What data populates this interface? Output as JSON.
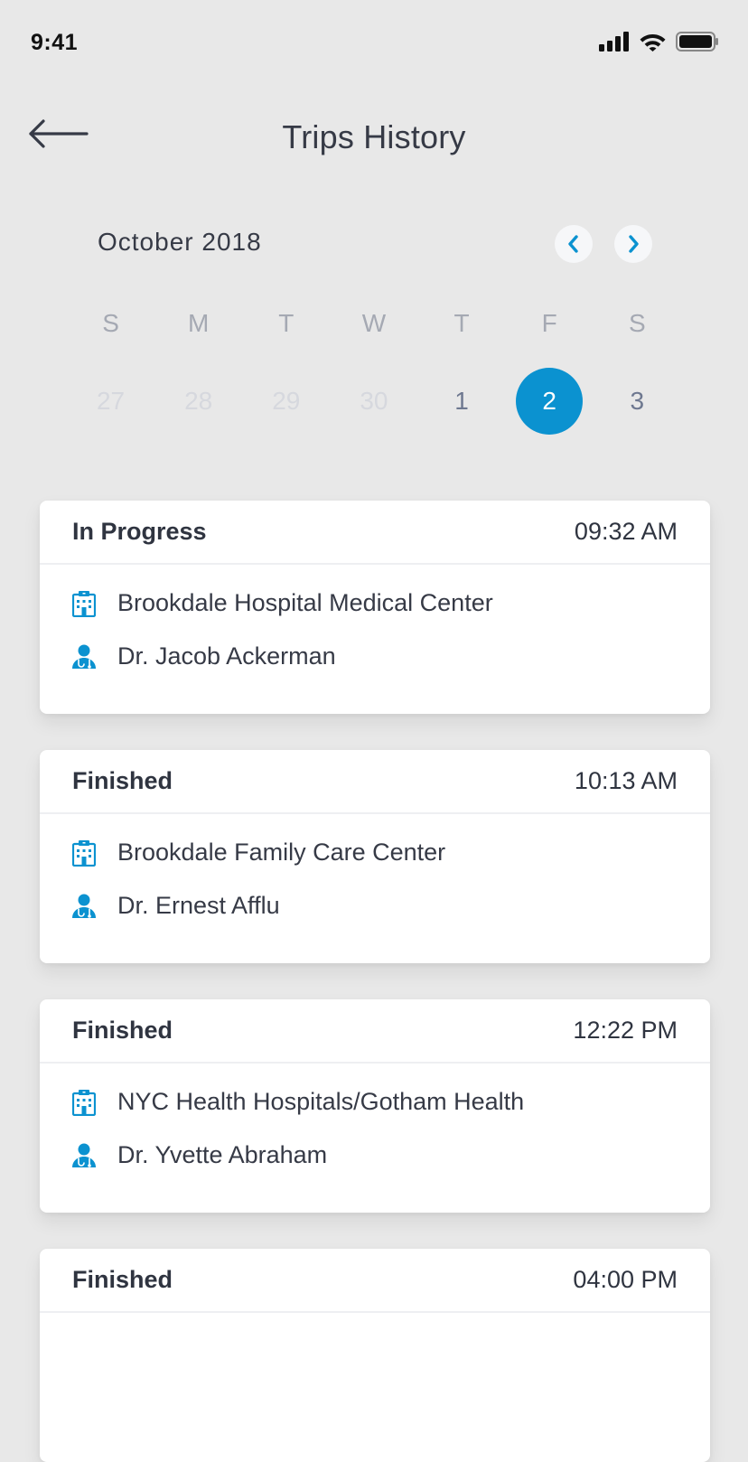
{
  "status_bar": {
    "time": "9:41",
    "icons": [
      "signal-icon",
      "wifi-icon",
      "battery-icon"
    ]
  },
  "header": {
    "title": "Trips History",
    "back_icon": "back-arrow-icon"
  },
  "calendar": {
    "month": "October 2018",
    "weekdays": [
      "S",
      "M",
      "T",
      "W",
      "T",
      "F",
      "S"
    ],
    "days": [
      {
        "label": "27",
        "state": "muted"
      },
      {
        "label": "28",
        "state": "muted"
      },
      {
        "label": "29",
        "state": "muted"
      },
      {
        "label": "30",
        "state": "muted"
      },
      {
        "label": "1",
        "state": "active"
      },
      {
        "label": "2",
        "state": "selected"
      },
      {
        "label": "3",
        "state": "active"
      }
    ],
    "prev_icon": "chevron-left-icon",
    "next_icon": "chevron-right-icon"
  },
  "trips": [
    {
      "status": "In Progress",
      "time": "09:32 AM",
      "place": "Brookdale Hospital Medical Center",
      "doctor": "Dr. Jacob Ackerman"
    },
    {
      "status": "Finished",
      "time": "10:13 AM",
      "place": "Brookdale Family Care Center",
      "doctor": "Dr. Ernest Afflu"
    },
    {
      "status": "Finished",
      "time": "12:22 PM",
      "place": "NYC Health Hospitals/Gotham Health",
      "doctor": "Dr. Yvette Abraham"
    },
    {
      "status": "Finished",
      "time": "04:00 PM",
      "place": "",
      "doctor": ""
    }
  ],
  "colors": {
    "accent": "#0b92d0",
    "background": "#e8e8e8",
    "card": "#ffffff",
    "text": "#2f3440",
    "muted": "#d6d8de"
  }
}
